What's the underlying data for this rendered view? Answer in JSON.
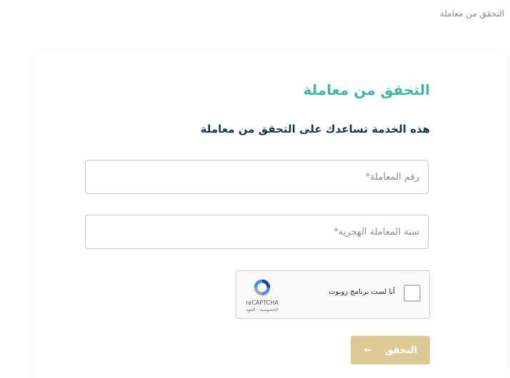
{
  "breadcrumb": {
    "text": "التحقق من معاملة"
  },
  "page": {
    "title": "التحقق من معاملة",
    "subtitle": "هذه الخدمة تساعدك على التحقق من معاملة"
  },
  "form": {
    "transaction_number": {
      "placeholder": "رقم المعاملة*",
      "value": ""
    },
    "hijri_year": {
      "placeholder": "سنة المعاملة الهجرية*",
      "value": ""
    }
  },
  "captcha": {
    "label": "أنا لست برنامج روبوت",
    "brand": "reCAPTCHA",
    "links": "الخصوصية - البنود",
    "checked": false
  },
  "submit": {
    "label": "التحقق",
    "icon": "arrow-left-icon"
  },
  "colors": {
    "title": "#3fb6a8",
    "subtitle": "#16384a",
    "button": "#dccb95"
  }
}
